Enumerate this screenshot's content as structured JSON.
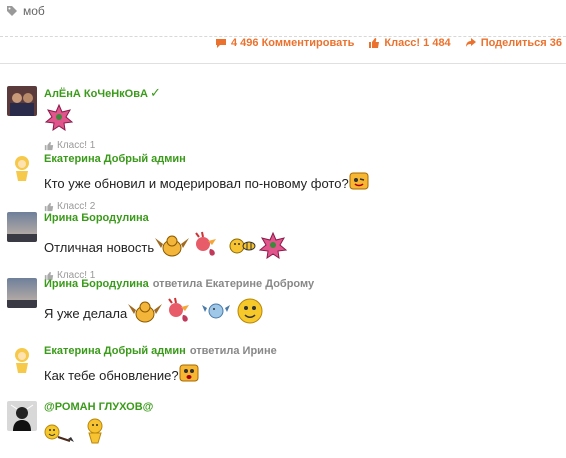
{
  "tag": {
    "label": "моб"
  },
  "actions": {
    "comments": "4 496 Комментировать",
    "likes": "Класс! 1 484",
    "shares": "Поделиться 36"
  },
  "comments": [
    {
      "author": "АлЁнА КоЧеНкОвА",
      "reply_to": "",
      "text": "",
      "like": "Класс! 1"
    },
    {
      "author": "Екатерина Добрый админ",
      "reply_to": "",
      "text": "Кто уже обновил и модерировал по-новому фото?",
      "like": "Класс! 2"
    },
    {
      "author": "Ирина Бородулина",
      "reply_to": "",
      "text": "Отличная новость",
      "like": "Класс! 1"
    },
    {
      "author": "Ирина Бородулина",
      "reply_to": "ответила Екатерине Доброму",
      "text": "Я уже делала",
      "like": ""
    },
    {
      "author": "Екатерина Добрый админ",
      "reply_to": "ответила Ирине",
      "text": "Как тебе обновление?",
      "like": ""
    },
    {
      "author": "@РОМАН ГЛУХОВ@",
      "reply_to": "",
      "text": "",
      "like": ""
    }
  ],
  "colors": {
    "accent": "#eb722e",
    "author": "#3a9a19",
    "meta": "#999999"
  }
}
